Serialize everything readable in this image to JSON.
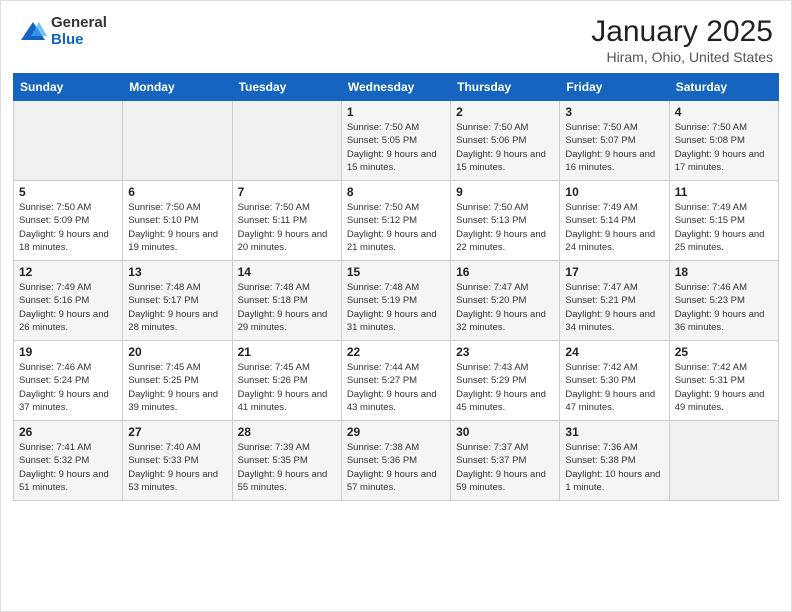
{
  "logo": {
    "general": "General",
    "blue": "Blue"
  },
  "header": {
    "month": "January 2025",
    "location": "Hiram, Ohio, United States"
  },
  "weekdays": [
    "Sunday",
    "Monday",
    "Tuesday",
    "Wednesday",
    "Thursday",
    "Friday",
    "Saturday"
  ],
  "weeks": [
    [
      {
        "day": "",
        "info": ""
      },
      {
        "day": "",
        "info": ""
      },
      {
        "day": "",
        "info": ""
      },
      {
        "day": "1",
        "info": "Sunrise: 7:50 AM\nSunset: 5:05 PM\nDaylight: 9 hours\nand 15 minutes."
      },
      {
        "day": "2",
        "info": "Sunrise: 7:50 AM\nSunset: 5:06 PM\nDaylight: 9 hours\nand 15 minutes."
      },
      {
        "day": "3",
        "info": "Sunrise: 7:50 AM\nSunset: 5:07 PM\nDaylight: 9 hours\nand 16 minutes."
      },
      {
        "day": "4",
        "info": "Sunrise: 7:50 AM\nSunset: 5:08 PM\nDaylight: 9 hours\nand 17 minutes."
      }
    ],
    [
      {
        "day": "5",
        "info": "Sunrise: 7:50 AM\nSunset: 5:09 PM\nDaylight: 9 hours\nand 18 minutes."
      },
      {
        "day": "6",
        "info": "Sunrise: 7:50 AM\nSunset: 5:10 PM\nDaylight: 9 hours\nand 19 minutes."
      },
      {
        "day": "7",
        "info": "Sunrise: 7:50 AM\nSunset: 5:11 PM\nDaylight: 9 hours\nand 20 minutes."
      },
      {
        "day": "8",
        "info": "Sunrise: 7:50 AM\nSunset: 5:12 PM\nDaylight: 9 hours\nand 21 minutes."
      },
      {
        "day": "9",
        "info": "Sunrise: 7:50 AM\nSunset: 5:13 PM\nDaylight: 9 hours\nand 22 minutes."
      },
      {
        "day": "10",
        "info": "Sunrise: 7:49 AM\nSunset: 5:14 PM\nDaylight: 9 hours\nand 24 minutes."
      },
      {
        "day": "11",
        "info": "Sunrise: 7:49 AM\nSunset: 5:15 PM\nDaylight: 9 hours\nand 25 minutes."
      }
    ],
    [
      {
        "day": "12",
        "info": "Sunrise: 7:49 AM\nSunset: 5:16 PM\nDaylight: 9 hours\nand 26 minutes."
      },
      {
        "day": "13",
        "info": "Sunrise: 7:48 AM\nSunset: 5:17 PM\nDaylight: 9 hours\nand 28 minutes."
      },
      {
        "day": "14",
        "info": "Sunrise: 7:48 AM\nSunset: 5:18 PM\nDaylight: 9 hours\nand 29 minutes."
      },
      {
        "day": "15",
        "info": "Sunrise: 7:48 AM\nSunset: 5:19 PM\nDaylight: 9 hours\nand 31 minutes."
      },
      {
        "day": "16",
        "info": "Sunrise: 7:47 AM\nSunset: 5:20 PM\nDaylight: 9 hours\nand 32 minutes."
      },
      {
        "day": "17",
        "info": "Sunrise: 7:47 AM\nSunset: 5:21 PM\nDaylight: 9 hours\nand 34 minutes."
      },
      {
        "day": "18",
        "info": "Sunrise: 7:46 AM\nSunset: 5:23 PM\nDaylight: 9 hours\nand 36 minutes."
      }
    ],
    [
      {
        "day": "19",
        "info": "Sunrise: 7:46 AM\nSunset: 5:24 PM\nDaylight: 9 hours\nand 37 minutes."
      },
      {
        "day": "20",
        "info": "Sunrise: 7:45 AM\nSunset: 5:25 PM\nDaylight: 9 hours\nand 39 minutes."
      },
      {
        "day": "21",
        "info": "Sunrise: 7:45 AM\nSunset: 5:26 PM\nDaylight: 9 hours\nand 41 minutes."
      },
      {
        "day": "22",
        "info": "Sunrise: 7:44 AM\nSunset: 5:27 PM\nDaylight: 9 hours\nand 43 minutes."
      },
      {
        "day": "23",
        "info": "Sunrise: 7:43 AM\nSunset: 5:29 PM\nDaylight: 9 hours\nand 45 minutes."
      },
      {
        "day": "24",
        "info": "Sunrise: 7:42 AM\nSunset: 5:30 PM\nDaylight: 9 hours\nand 47 minutes."
      },
      {
        "day": "25",
        "info": "Sunrise: 7:42 AM\nSunset: 5:31 PM\nDaylight: 9 hours\nand 49 minutes."
      }
    ],
    [
      {
        "day": "26",
        "info": "Sunrise: 7:41 AM\nSunset: 5:32 PM\nDaylight: 9 hours\nand 51 minutes."
      },
      {
        "day": "27",
        "info": "Sunrise: 7:40 AM\nSunset: 5:33 PM\nDaylight: 9 hours\nand 53 minutes."
      },
      {
        "day": "28",
        "info": "Sunrise: 7:39 AM\nSunset: 5:35 PM\nDaylight: 9 hours\nand 55 minutes."
      },
      {
        "day": "29",
        "info": "Sunrise: 7:38 AM\nSunset: 5:36 PM\nDaylight: 9 hours\nand 57 minutes."
      },
      {
        "day": "30",
        "info": "Sunrise: 7:37 AM\nSunset: 5:37 PM\nDaylight: 9 hours\nand 59 minutes."
      },
      {
        "day": "31",
        "info": "Sunrise: 7:36 AM\nSunset: 5:38 PM\nDaylight: 10 hours\nand 1 minute."
      },
      {
        "day": "",
        "info": ""
      }
    ]
  ]
}
